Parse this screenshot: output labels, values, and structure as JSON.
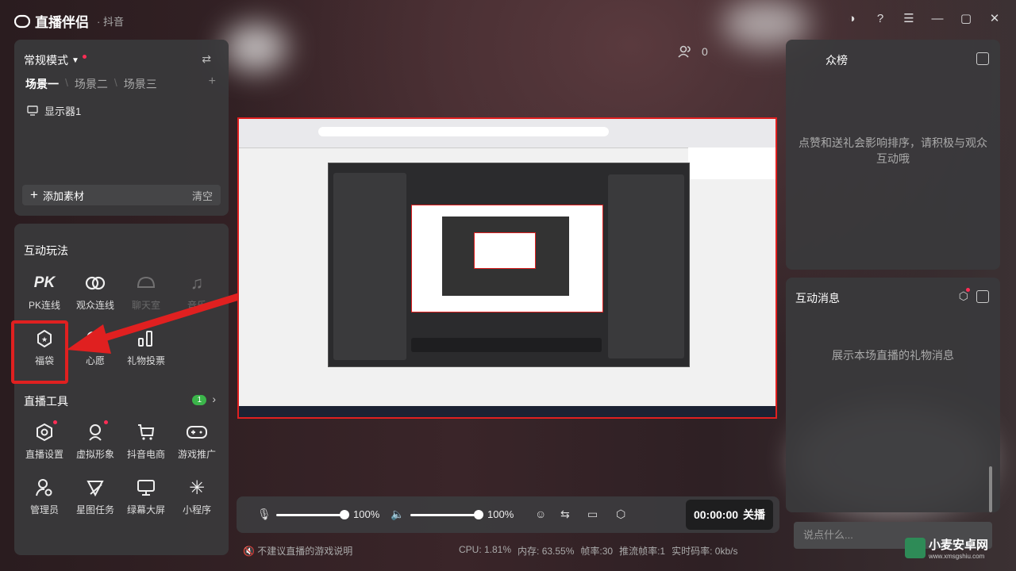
{
  "app": {
    "name": "直播伴侣",
    "platform": "· 抖音"
  },
  "scene_panel": {
    "mode_label": "常规模式",
    "tabs": [
      "场景一",
      "场景二",
      "场景三"
    ],
    "sources": [
      "显示器1"
    ],
    "add_label": "添加素材",
    "clear_label": "清空"
  },
  "interactive": {
    "title": "互动玩法",
    "items": [
      {
        "label": "PK连线",
        "icon": "pk-icon"
      },
      {
        "label": "观众连线",
        "icon": "link-icon"
      },
      {
        "label": "聊天室",
        "icon": "chat-room-icon"
      },
      {
        "label": "音乐",
        "icon": "music-icon"
      },
      {
        "label": "福袋",
        "icon": "lucky-bag-icon"
      },
      {
        "label": "心愿",
        "icon": "wish-icon"
      },
      {
        "label": "礼物投票",
        "icon": "gift-vote-icon"
      }
    ]
  },
  "live_tools": {
    "title": "直播工具",
    "badge": "1",
    "items": [
      {
        "label": "直播设置",
        "icon": "settings-icon"
      },
      {
        "label": "虚拟形象",
        "icon": "avatar-icon"
      },
      {
        "label": "抖音电商",
        "icon": "cart-icon"
      },
      {
        "label": "游戏推广",
        "icon": "gamepad-icon"
      },
      {
        "label": "管理员",
        "icon": "admin-icon"
      },
      {
        "label": "星图任务",
        "icon": "star-task-icon"
      },
      {
        "label": "绿幕大屏",
        "icon": "monitor-icon"
      },
      {
        "label": "小程序",
        "icon": "mini-program-icon"
      }
    ]
  },
  "viewers": {
    "count": "0"
  },
  "controls": {
    "mic_volume": "100%",
    "speaker_volume": "100%",
    "timer": "00:00:00",
    "stop_label": "关播"
  },
  "status": {
    "tip": "不建议直播的游戏说明",
    "cpu": "CPU: 1.81%",
    "memory": "内存: 63.55%",
    "fps": "帧率:30",
    "push_fps": "推流帧率:1",
    "bitrate": "实时码率: 0kb/s"
  },
  "rank_panel": {
    "title": "众榜",
    "empty": "点赞和送礼会影响排序，请积极与观众互动哦"
  },
  "messages_panel": {
    "title": "互动消息",
    "empty": "展示本场直播的礼物消息"
  },
  "chat": {
    "placeholder": "说点什么..."
  },
  "watermark": {
    "name": "小麦安卓网",
    "url": "www.xmsgshiu.com"
  },
  "colors": {
    "accent_red": "#e02020",
    "badge_green": "#3bb54a",
    "dot_red": "#ff2d55"
  }
}
